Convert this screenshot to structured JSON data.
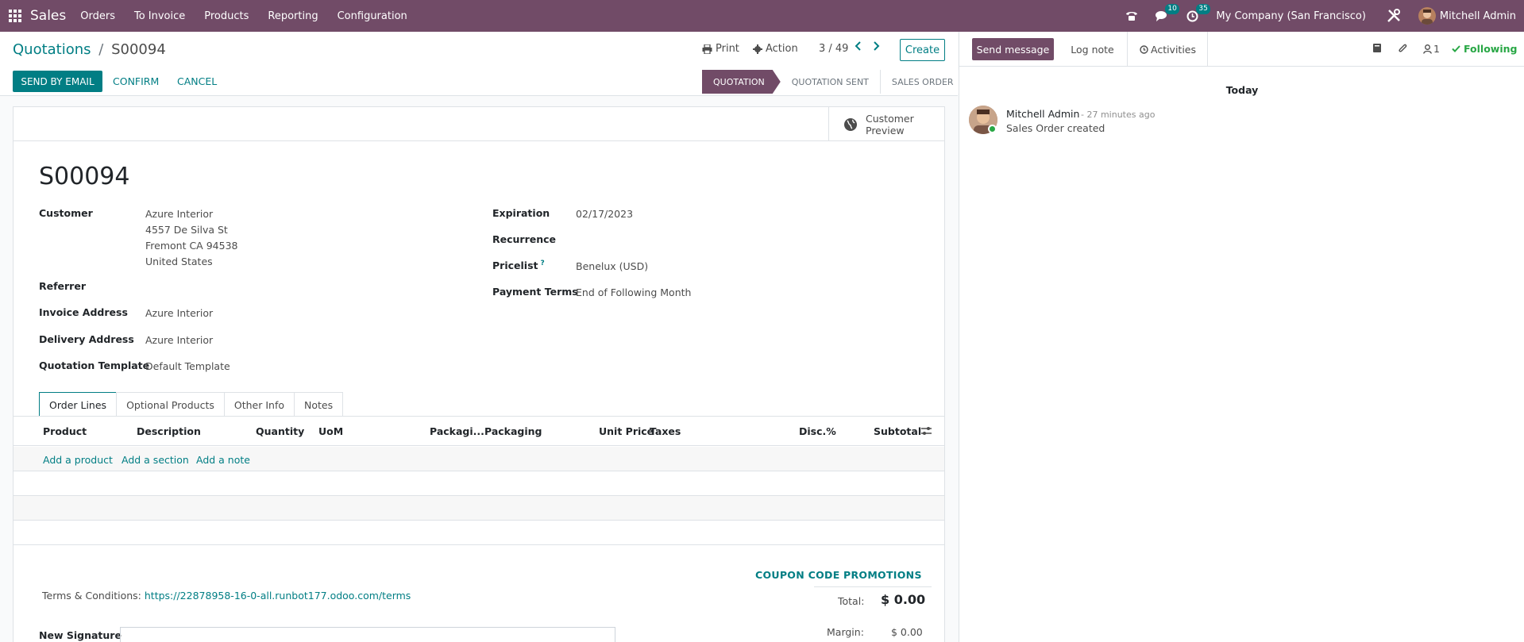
{
  "navbar": {
    "brand": "Sales",
    "menu": [
      "Orders",
      "To Invoice",
      "Products",
      "Reporting",
      "Configuration"
    ],
    "messages_count": "10",
    "activities_count": "35",
    "company": "My Company (San Francisco)",
    "user": "Mitchell Admin"
  },
  "control": {
    "breadcrumb_parent": "Quotations",
    "breadcrumb_sep": "/",
    "breadcrumb_current": "S00094",
    "print_label": "Print",
    "action_label": "Action",
    "pager": "3 / 49",
    "create_label": "Create",
    "send_email_label": "SEND BY EMAIL",
    "confirm_label": "CONFIRM",
    "cancel_label": "CANCEL",
    "stages": [
      "QUOTATION",
      "QUOTATION SENT",
      "SALES ORDER"
    ]
  },
  "form": {
    "preview_label_1": "Customer",
    "preview_label_2": "Preview",
    "title": "S00094",
    "customer_label": "Customer",
    "customer_lines": [
      "Azure Interior",
      "4557 De Silva St",
      "Fremont CA 94538",
      "United States"
    ],
    "referrer_label": "Referrer",
    "invoice_address_label": "Invoice Address",
    "invoice_address": "Azure Interior",
    "delivery_address_label": "Delivery Address",
    "delivery_address": "Azure Interior",
    "template_label": "Quotation Template",
    "template": "Default Template",
    "expiration_label": "Expiration",
    "expiration": "02/17/2023",
    "recurrence_label": "Recurrence",
    "pricelist_label": "Pricelist",
    "pricelist_help": "?",
    "pricelist": "Benelux (USD)",
    "payment_terms_label": "Payment Terms",
    "payment_terms": "End of Following Month"
  },
  "tabs": [
    "Order Lines",
    "Optional Products",
    "Other Info",
    "Notes"
  ],
  "table": {
    "columns": [
      "Product",
      "Description",
      "Quantity",
      "UoM",
      "Packagi...",
      "Packaging",
      "Unit Price",
      "Taxes",
      "Disc.%",
      "Subtotal"
    ],
    "add_product": "Add a product",
    "add_section": "Add a section",
    "add_note": "Add a note"
  },
  "footer": {
    "coupon_label": "COUPON CODE",
    "promotions_label": "PROMOTIONS",
    "terms_label": "Terms & Conditions:",
    "terms_url": "https://22878958-16-0-all.runbot177.odoo.com/terms",
    "total_label": "Total:",
    "total_value": "$ 0.00",
    "margin_label": "Margin:",
    "margin_value": "$ 0.00",
    "signature_label": "New Signature"
  },
  "chatter": {
    "send_message_label": "Send message",
    "log_note_label": "Log note",
    "activities_label": "Activities",
    "followers_count": "1",
    "following_label": "Following",
    "date_separator": "Today",
    "message": {
      "author": "Mitchell Admin",
      "time": "- 27 minutes ago",
      "body": "Sales Order created"
    }
  }
}
